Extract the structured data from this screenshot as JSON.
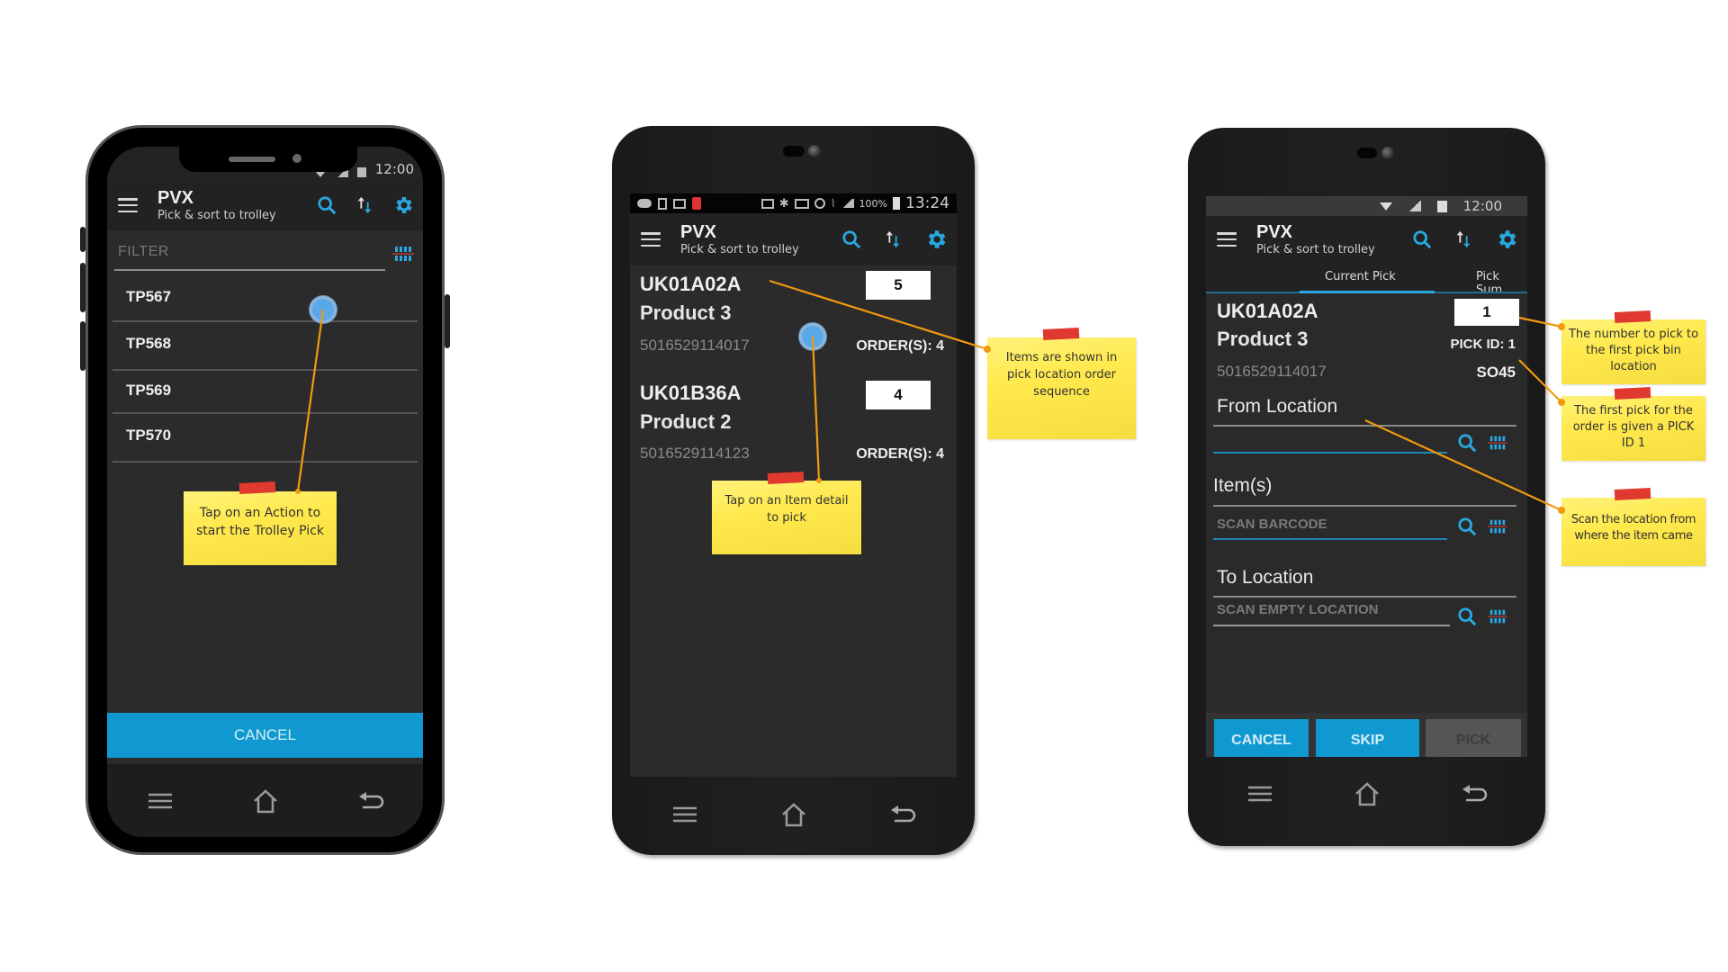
{
  "colors": {
    "accent": "#29a8e0",
    "button_blue": "#0f99d0",
    "button_disabled": "#555555",
    "screen_bg": "#2b2b2b",
    "note_yellow": "#ffe94d",
    "note_tape": "#e03a30",
    "connector": "#f09a10"
  },
  "phone1": {
    "status": {
      "time": "12:00"
    },
    "appbar": {
      "title": "PVX",
      "subtitle": "Pick & sort to trolley",
      "icons": [
        "menu-icon",
        "search-icon",
        "sort-icon",
        "gear-icon"
      ]
    },
    "filter": {
      "placeholder": "FILTER"
    },
    "trolleys": [
      "TP567",
      "TP568",
      "TP569",
      "TP570"
    ],
    "cancel_label": "CANCEL",
    "note": {
      "line1": "Tap on an Action to",
      "line2": "start the Trolley Pick"
    },
    "navbar": [
      "menu-icon",
      "home-icon",
      "back-icon"
    ]
  },
  "phone2": {
    "status": {
      "battery": "100%",
      "time": "13:24"
    },
    "appbar": {
      "title": "PVX",
      "subtitle": "Pick & sort to trolley"
    },
    "items": [
      {
        "location": "UK01A02A",
        "product": "Product 3",
        "barcode": "5016529114017",
        "qty": "5",
        "orders": "ORDER(S): 4"
      },
      {
        "location": "UK01B36A",
        "product": "Product 2",
        "barcode": "5016529114123",
        "qty": "4",
        "orders": "ORDER(S): 4"
      }
    ],
    "note_tap": {
      "line1": "Tap on an Item detail",
      "line2": "to pick"
    },
    "note_sequence": {
      "line1": "Items are shown in",
      "line2": "pick location order",
      "line3": "sequence"
    }
  },
  "phone3": {
    "status": {
      "time": "12:00"
    },
    "appbar": {
      "title": "PVX",
      "subtitle": "Pick & sort to trolley"
    },
    "tabs": [
      {
        "label": "Current Pick",
        "active": true
      },
      {
        "label": "Pick Sum",
        "active": false
      }
    ],
    "pick": {
      "location": "UK01A02A",
      "product": "Product 3",
      "barcode": "5016529114017",
      "qty": "1",
      "pick_id": "PICK ID: 1",
      "order": "SO45"
    },
    "from_location": {
      "label": "From Location",
      "value": ""
    },
    "items": {
      "label": "Item(s)",
      "placeholder": "SCAN BARCODE"
    },
    "to_location": {
      "label": "To Location",
      "placeholder": "SCAN EMPTY LOCATION"
    },
    "buttons": {
      "cancel": "CANCEL",
      "skip": "SKIP",
      "pick": "PICK"
    }
  },
  "side_notes": {
    "qty": {
      "line1": "The number to pick to",
      "line2": "the first pick bin",
      "line3": "location"
    },
    "pick_id": {
      "line1": "The first pick for the",
      "line2": "order is given a PICK",
      "line3": "ID 1"
    },
    "scan_location": {
      "line1": "Scan the location from",
      "line2": "where the item came"
    }
  }
}
